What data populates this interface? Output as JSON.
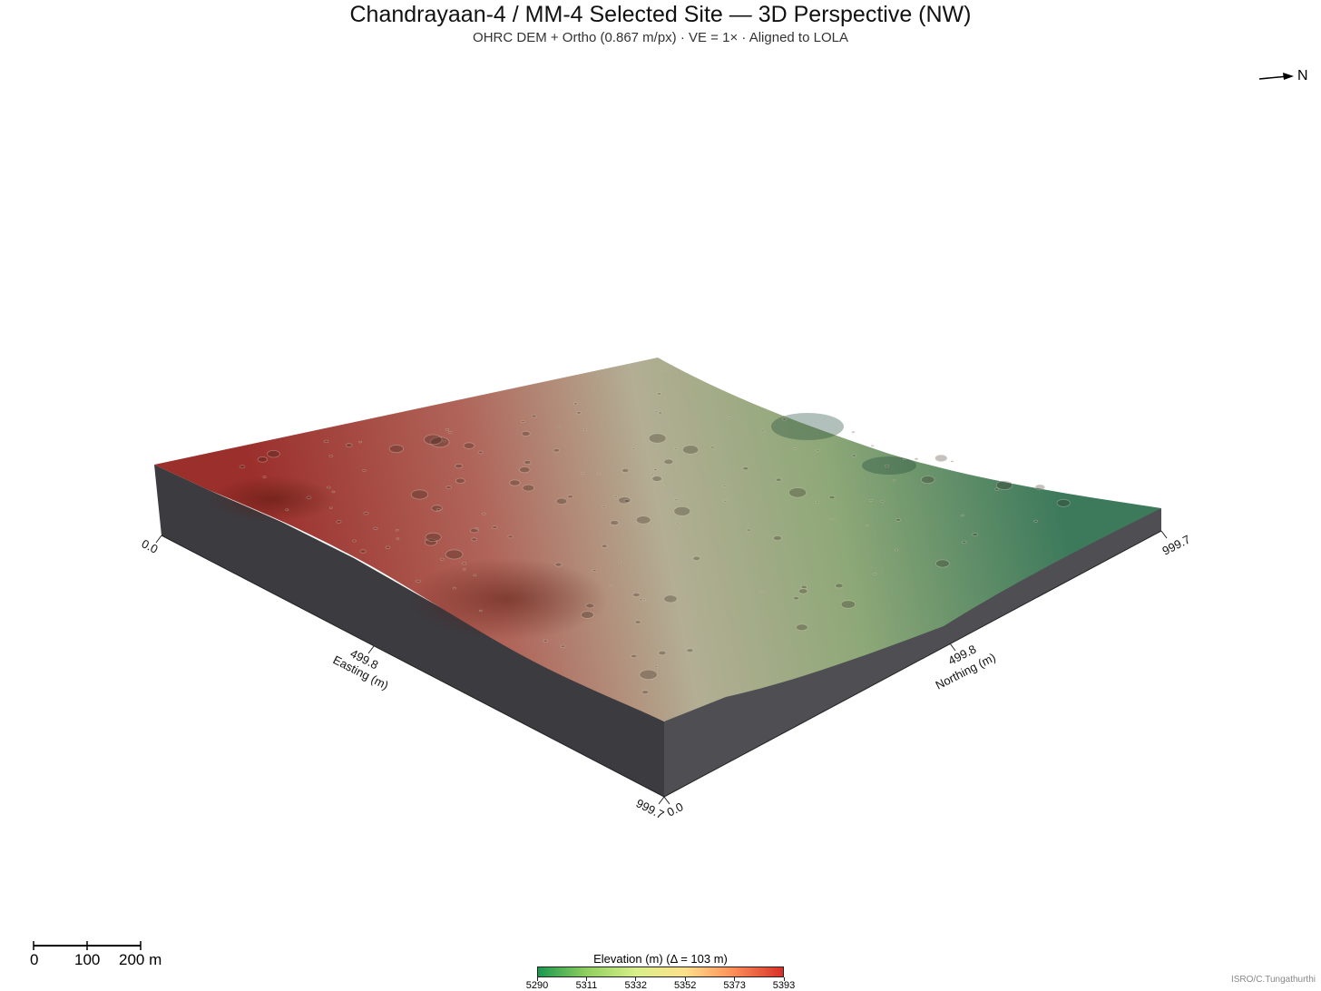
{
  "header": {
    "title": "Chandrayaan-4 / MM-4 Selected Site — 3D Perspective (NW)",
    "subtitle": "OHRC DEM + Ortho (0.867 m/px) · VE = 1× · Aligned to LOLA"
  },
  "north_arrow": {
    "label": "N"
  },
  "axes": {
    "easting": {
      "label": "Easting (m)",
      "ticks": [
        "0.0",
        "499.8",
        "999.7"
      ]
    },
    "northing": {
      "label": "Northing (m)",
      "ticks": [
        "0.0",
        "499.8",
        "999.7"
      ]
    }
  },
  "scalebar": {
    "ticks": [
      "0",
      "100",
      "200 m"
    ]
  },
  "colorbar": {
    "title": "Elevation (m)  (Δ = 103 m)",
    "ticks": [
      "5290",
      "5311",
      "5332",
      "5352",
      "5373",
      "5393"
    ],
    "colors": [
      "#1a9850",
      "#91cf60",
      "#d9ef8b",
      "#fee08b",
      "#fc8d59",
      "#d73027"
    ]
  },
  "credit": "ISRO/C.Tungathurthi",
  "colors": {
    "block_side_left": "#3c3b40",
    "block_side_right": "#4f4e53",
    "surface_high": "#9e3b36",
    "surface_mid": "#a9a58a",
    "surface_low": "#3f7a5c"
  }
}
